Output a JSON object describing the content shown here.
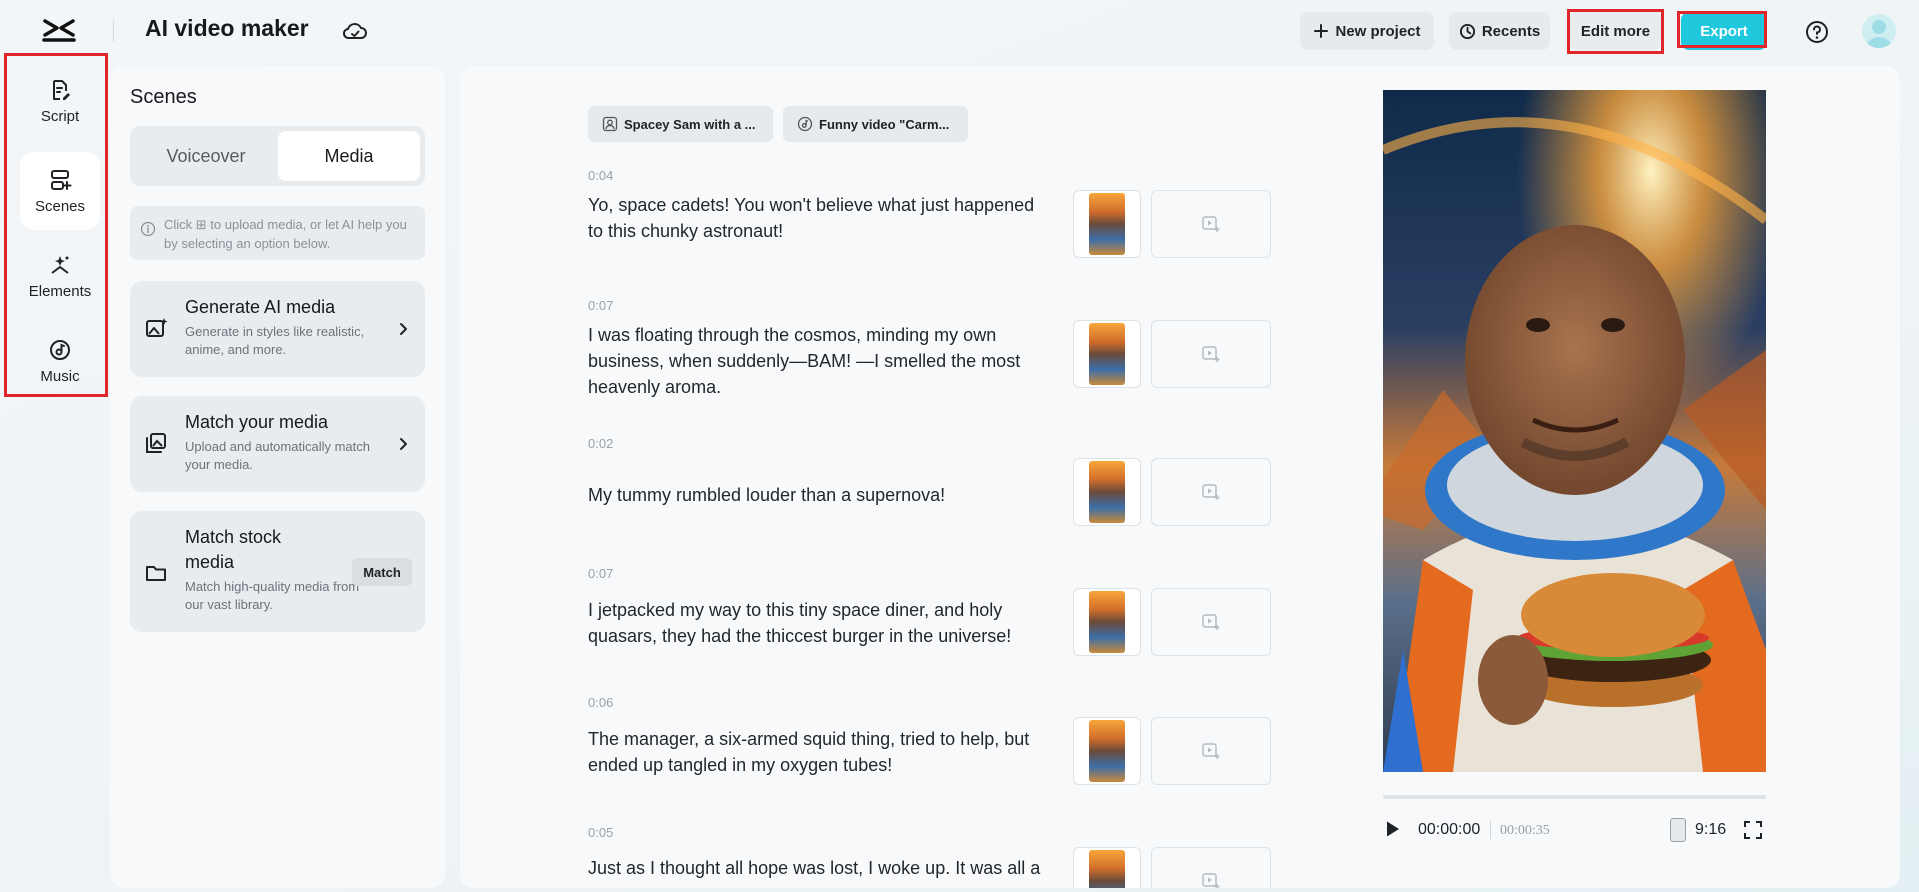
{
  "header": {
    "app_title": "AI video maker",
    "new_project": "New project",
    "recents": "Recents",
    "edit_more": "Edit more",
    "export": "Export",
    "icons": [
      "capcut-logo-icon",
      "cloud-sync-icon",
      "plus-icon",
      "clock-icon",
      "help-icon",
      "avatar"
    ]
  },
  "rail": {
    "items": [
      {
        "label": "Script",
        "icon": "script-icon"
      },
      {
        "label": "Scenes",
        "icon": "scenes-icon",
        "active": true
      },
      {
        "label": "Elements",
        "icon": "elements-icon"
      },
      {
        "label": "Music",
        "icon": "music-icon"
      }
    ]
  },
  "scenes_panel": {
    "title": "Scenes",
    "tabs": [
      "Voiceover",
      "Media"
    ],
    "active_tab": "Media",
    "hint": "Click ⊞ to upload media, or let AI help you by selecting an option below.",
    "cards": [
      {
        "title": "Generate AI media",
        "desc": "Generate in styles like realistic, anime, and more."
      },
      {
        "title": "Match your media",
        "desc": "Upload and automatically match your media."
      },
      {
        "title": "Match stock media",
        "desc": "Match high-quality media from our vast library.",
        "button": "Match"
      }
    ]
  },
  "main": {
    "chips": [
      "Spacey Sam with a ...",
      "Funny video \"Carm..."
    ],
    "scenes": [
      {
        "duration": "0:04",
        "text": "Yo, space cadets! You won't believe what just happened to this chunky astronaut!"
      },
      {
        "duration": "0:07",
        "text": "I was floating through the cosmos, minding my own business, when suddenly—BAM! —I smelled the most heavenly aroma."
      },
      {
        "duration": "0:02",
        "text": "My tummy rumbled louder than a supernova!"
      },
      {
        "duration": "0:07",
        "text": "I jetpacked my way to this tiny space diner, and holy quasars, they had the thiccest burger in the universe!"
      },
      {
        "duration": "0:06",
        "text": "The manager, a six-armed squid thing, tried to help, but ended up tangled in my oxygen tubes!"
      },
      {
        "duration": "0:05",
        "text": "Just as I thought all hope was lost, I woke up. It was all a"
      }
    ]
  },
  "player": {
    "current_time": "00:00:00",
    "total_time": "00:00:35",
    "aspect_ratio": "9:16"
  },
  "colors": {
    "accent": "#1fc8dc",
    "highlight_border": "#e0262b"
  }
}
